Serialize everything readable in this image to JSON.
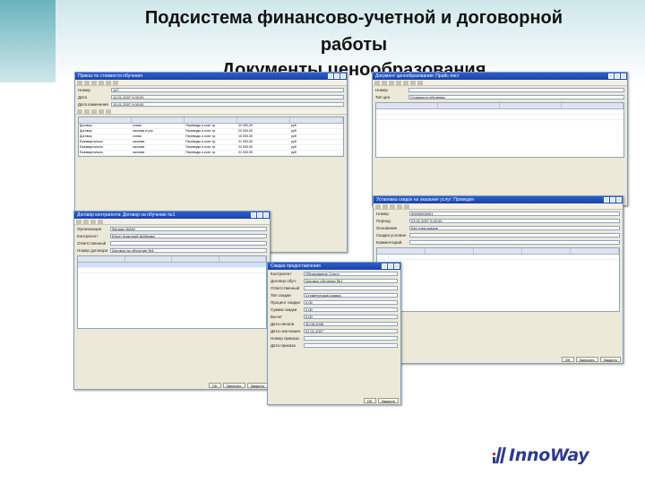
{
  "slide": {
    "title_line1": "Подсистема финансово-учетной и договорной",
    "title_line2": "работы",
    "title_line3": "Документы ценообразования"
  },
  "logo": {
    "text": "InnoWay",
    "colors": {
      "red": "#d0312d",
      "blue": "#2d3b8a"
    }
  },
  "windows": {
    "w1": {
      "title": "Приказ по стоимости обучения",
      "fields": [
        {
          "label": "Номер",
          "value": "147"
        },
        {
          "label": "Дата",
          "value": "10.01.2007 0:00:00"
        },
        {
          "label": "Дата изменения",
          "value": "10.01.2007 0:00:00"
        }
      ],
      "rows": [
        [
          "Договор",
          "очная",
          "Переводы и кохе тр.",
          "22 000,00",
          "руб"
        ],
        [
          "Договор",
          "заочная в уск.",
          "Переводы и кохе тр.",
          "22 000,00",
          "руб"
        ],
        [
          "Договор",
          "очная",
          "Переводы и кохе тр.",
          "10 000,00",
          "руб"
        ],
        [
          "Ежеквартально",
          "заочная",
          "Переводы и кохе тр.",
          "21 000,00",
          "руб"
        ],
        [
          "Ежеквартально",
          "заочная",
          "Переводы и кохе тр.",
          "24 000,00",
          "руб"
        ],
        [
          "Ежеквартально",
          "заочная",
          "Переводы и кохе тр.",
          "21 000,00",
          "руб"
        ]
      ]
    },
    "w2": {
      "title": "Договор контрагента: Договор на обучение №1",
      "fields": [
        {
          "label": "Организация",
          "value": "Филиал ИИАУ"
        },
        {
          "label": "Контрагент",
          "value": "Юрин Анатолий Шаброва"
        },
        {
          "label": "Ответственный",
          "value": ""
        },
        {
          "label": "Номер договора",
          "value": "Договор на обучение №1"
        }
      ],
      "status": {
        "ok": "OK",
        "write": "Записать",
        "close": "Закрыть"
      }
    },
    "w3": {
      "title": "Документ ценообразования: Прайс-лист",
      "fields": [
        {
          "label": "Номер",
          "value": ""
        },
        {
          "label": "Тип цен",
          "value": "Стоимость обучения"
        }
      ]
    },
    "w4": {
      "title": "Установка скидок на оказание услуг: Проведен",
      "fields": [
        {
          "label": "Номер",
          "value": "00000000001"
        },
        {
          "label": "Период",
          "value": "23.01.2007 0:00:00"
        },
        {
          "label": "Основание",
          "value": "Без типа скидок"
        },
        {
          "label": "Скидка условие",
          "value": ""
        },
        {
          "label": "Комментарий",
          "value": ""
        }
      ],
      "status": {
        "ok": "OK",
        "write": "Записать",
        "close": "Закрыть"
      }
    },
    "w5": {
      "title": "Скидка предоставления",
      "fields": [
        {
          "label": "Контрагент",
          "value": "Образование Сургут"
        },
        {
          "label": "Договор обуч.",
          "value": "Договор обучения №1"
        },
        {
          "label": "Ответственный",
          "value": ""
        },
        {
          "label": "Тип скидки",
          "value": "Студенческая скидка"
        },
        {
          "label": "Процент скидки",
          "value": "2,00"
        },
        {
          "label": "Сумма скидки",
          "value": "0,00"
        },
        {
          "label": "Вычет",
          "value": "0,00"
        },
        {
          "label": "Дата начала",
          "value": "30.08.2008"
        },
        {
          "label": "Дата окончания",
          "value": "01.01.2007"
        },
        {
          "label": "Номер приказа",
          "value": ""
        },
        {
          "label": "Дата приказа",
          "value": ""
        }
      ],
      "status": {
        "ok": "OK",
        "close": "Закрыть"
      }
    }
  }
}
